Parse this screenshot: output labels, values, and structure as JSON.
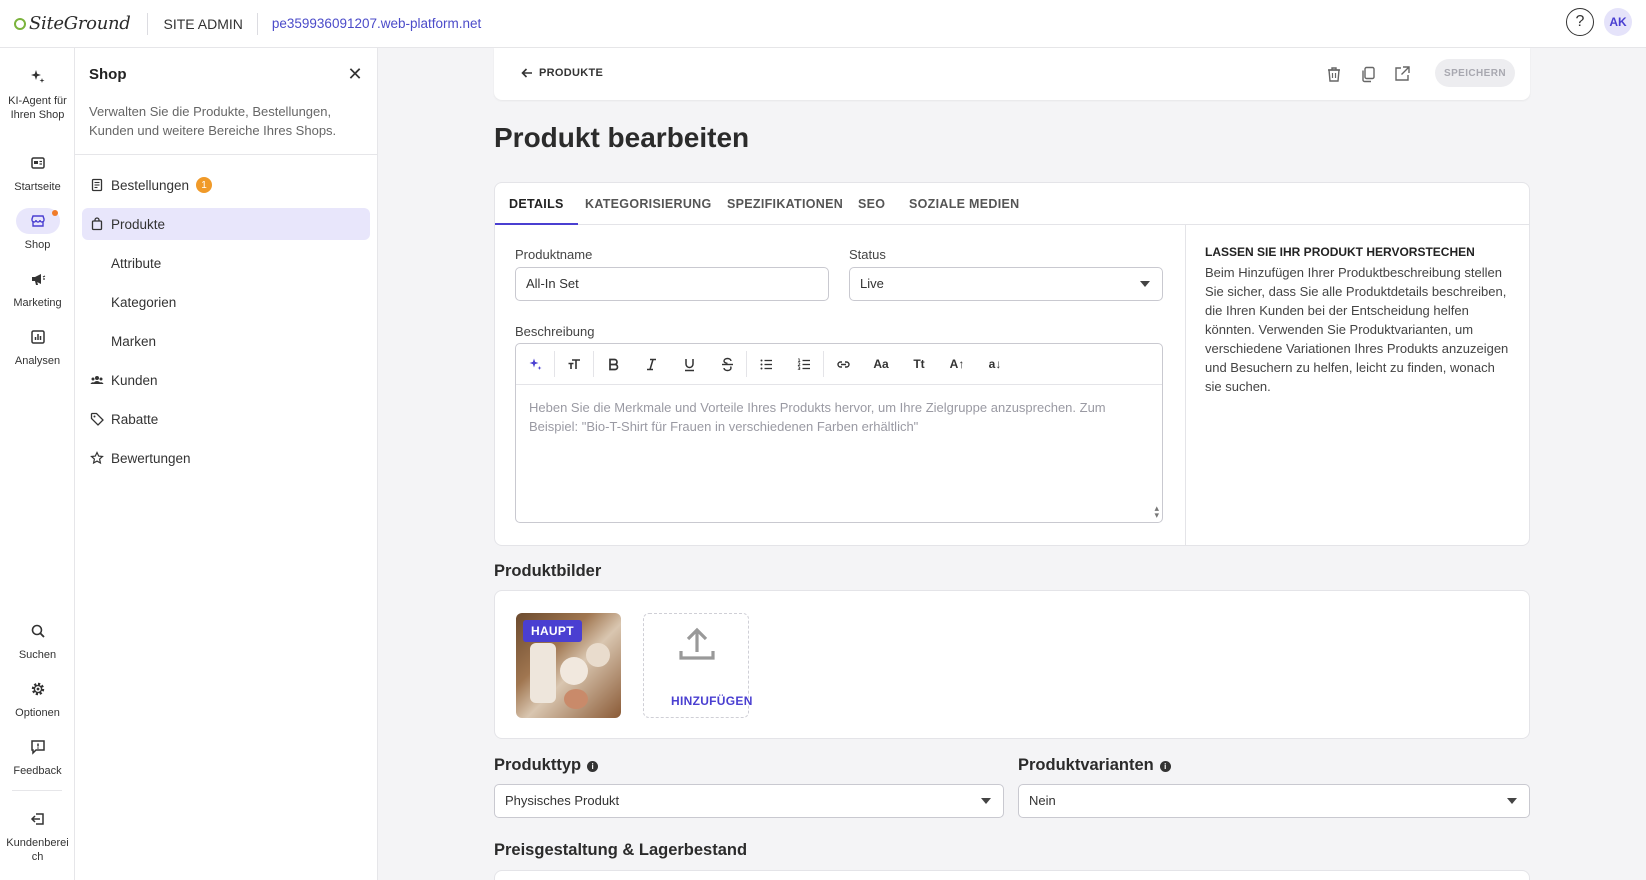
{
  "topbar": {
    "logo_text": "SiteGround",
    "site_admin": "SITE ADMIN",
    "domain": "pe359936091207.web-platform.net",
    "help": "?",
    "avatar": "AK"
  },
  "rail": {
    "items": [
      {
        "label": "KI-Agent für Ihren Shop",
        "icon": "sparkle-icon"
      },
      {
        "label": "Startseite",
        "icon": "home-icon"
      },
      {
        "label": "Shop",
        "icon": "store-icon"
      },
      {
        "label": "Marketing",
        "icon": "megaphone-icon"
      },
      {
        "label": "Analysen",
        "icon": "chart-icon"
      },
      {
        "label": "Suchen",
        "icon": "search-icon"
      },
      {
        "label": "Optionen",
        "icon": "gear-icon"
      },
      {
        "label": "Feedback",
        "icon": "feedback-icon"
      },
      {
        "label": "Kundenbereich",
        "icon": "exit-icon"
      }
    ]
  },
  "panel": {
    "title": "Shop",
    "description": "Verwalten Sie die Produkte, Bestellungen, Kunden und weitere Bereiche Ihres Shops.",
    "nav": [
      {
        "label": "Bestellungen",
        "badge": "1"
      },
      {
        "label": "Produkte"
      },
      {
        "label": "Attribute"
      },
      {
        "label": "Kategorien"
      },
      {
        "label": "Marken"
      },
      {
        "label": "Kunden"
      },
      {
        "label": "Rabatte"
      },
      {
        "label": "Bewertungen"
      }
    ]
  },
  "toolbar": {
    "back_label": "PRODUKTE",
    "save_label": "SPEICHERN"
  },
  "page": {
    "title": "Produkt bearbeiten"
  },
  "tabs": [
    "DETAILS",
    "KATEGORISIERUNG",
    "SPEZIFIKATIONEN",
    "SEO",
    "SOZIALE MEDIEN"
  ],
  "details": {
    "name_label": "Produktname",
    "name_value": "All-In Set",
    "status_label": "Status",
    "status_value": "Live",
    "description_label": "Beschreibung",
    "description_placeholder": "Heben Sie die Merkmale und Vorteile Ihres Produkts hervor, um Ihre Zielgruppe anzusprechen. Zum Beispiel: \"Bio-T-Shirt für Frauen in verschiedenen Farben erhältlich\"",
    "editor_tools": {
      "aa": "Aa",
      "tt": "Tt",
      "a_up": "A↑",
      "a_down": "a↓"
    },
    "tip_title": "LASSEN SIE IHR PRODUKT HERVORSTECHEN",
    "tip_body": "Beim Hinzufügen Ihrer Produktbeschreibung stellen Sie sicher, dass Sie alle Produktdetails beschreiben, die Ihren Kunden bei der Entscheidung helfen könnten. Verwenden Sie Produktvarianten, um verschiedene Variationen Ihres Produkts anzuzeigen und Besuchern zu helfen, leicht zu finden, wonach sie suchen."
  },
  "images": {
    "title": "Produktbilder",
    "main_badge": "HAUPT",
    "add_label": "HINZUFÜGEN"
  },
  "product_type": {
    "title": "Produkttyp",
    "value": "Physisches Produkt"
  },
  "variants": {
    "title": "Produktvarianten",
    "value": "Nein"
  },
  "pricing": {
    "title": "Preisgestaltung & Lagerbestand"
  },
  "colors": {
    "accent": "#4a3fd1",
    "badge_orange": "#f09a29",
    "active_bg": "#e8e6fb"
  }
}
